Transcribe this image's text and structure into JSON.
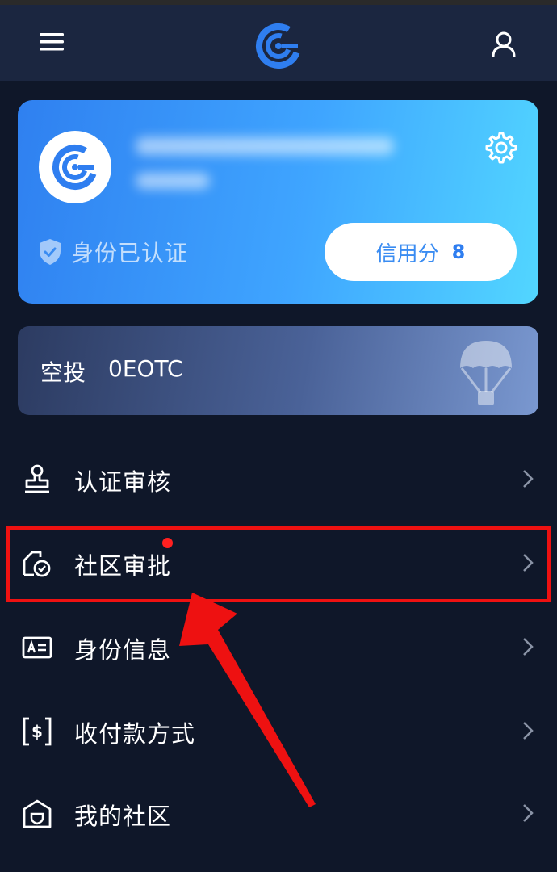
{
  "header": {
    "menu_icon": "hamburger-menu-icon",
    "logo_icon": "app-logo-icon",
    "user_icon": "user-profile-icon"
  },
  "profile": {
    "settings_icon": "gear-icon",
    "verified_label": "身份已认证",
    "credit_label": "信用分",
    "credit_value": "8"
  },
  "airdrop": {
    "label": "空投",
    "amount": "0EOTC",
    "icon": "parachute-icon"
  },
  "menu": [
    {
      "label": "认证审核",
      "icon": "stamp-icon"
    },
    {
      "label": "社区审批",
      "icon": "community-approve-icon",
      "has_badge": true
    },
    {
      "label": "身份信息",
      "icon": "id-card-icon"
    },
    {
      "label": "收付款方式",
      "icon": "payment-method-icon"
    },
    {
      "label": "我的社区",
      "icon": "my-community-icon"
    }
  ],
  "colors": {
    "background": "#0f1729",
    "header": "#1b2640",
    "card_start": "#2f80f0",
    "card_end": "#52d6ff",
    "accent": "#3a8cf2",
    "badge": "#ff2020",
    "highlight": "#ee1111"
  }
}
